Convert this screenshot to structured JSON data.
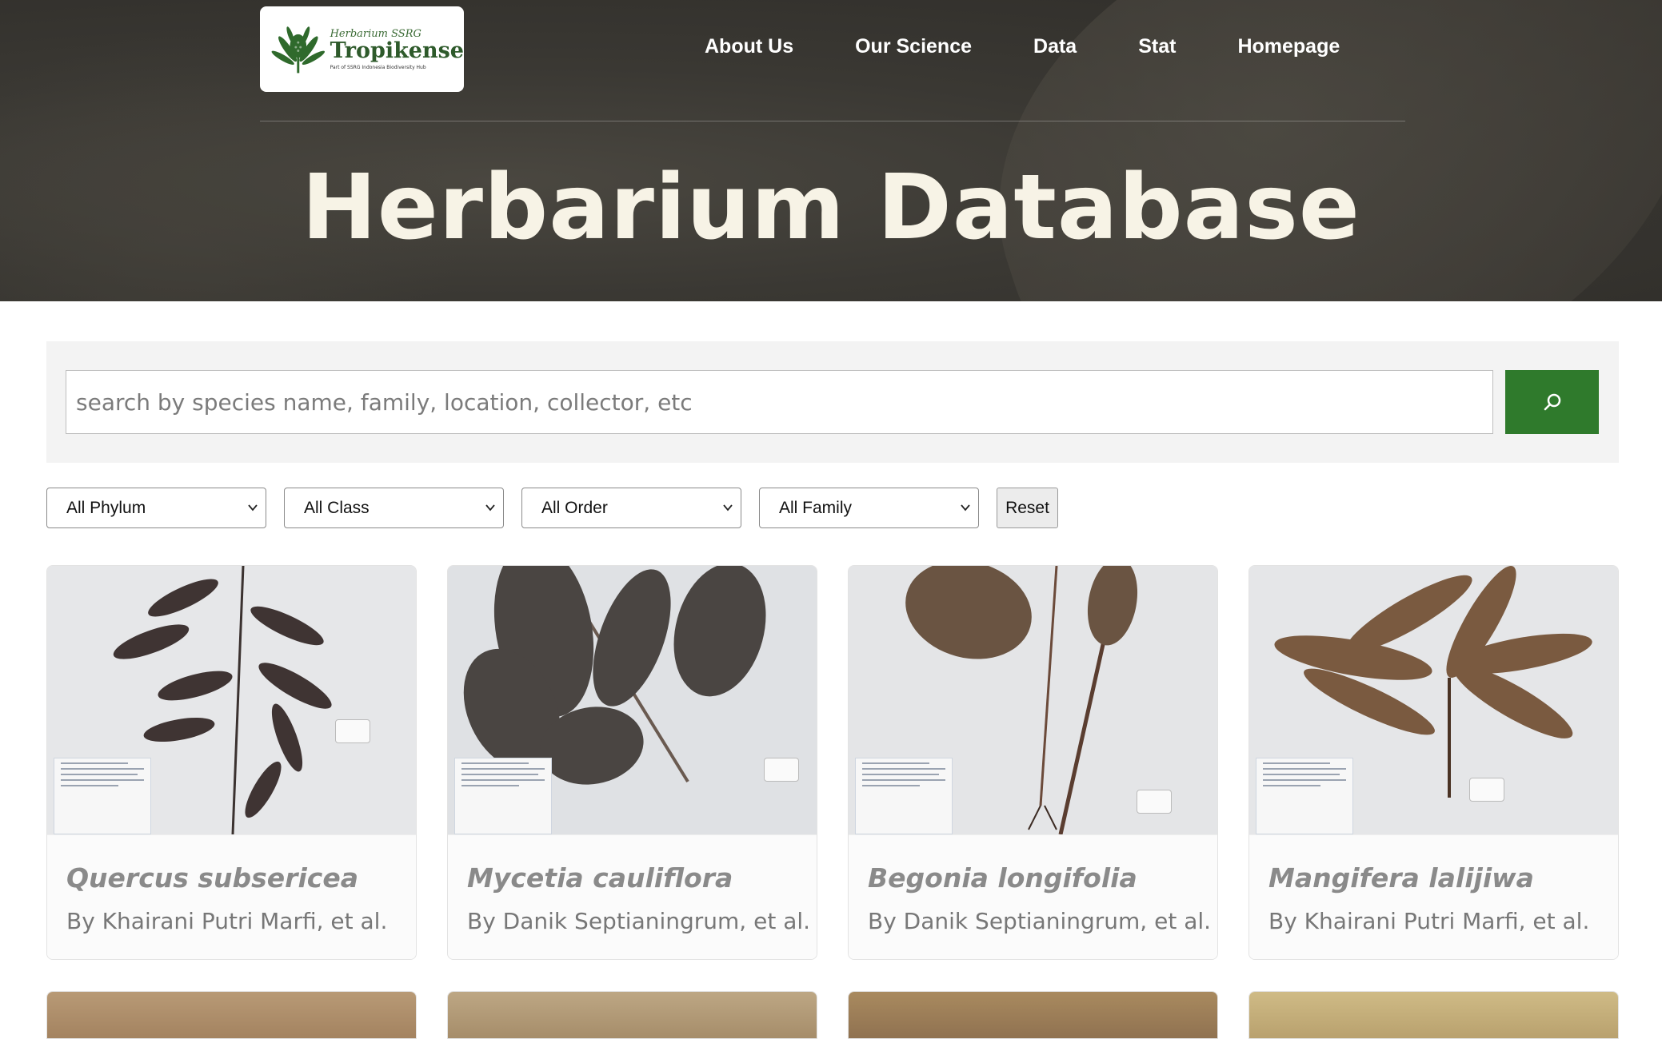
{
  "logo": {
    "script_text": "Herbarium SSRG",
    "brand": "Tropikense",
    "part_text": "Part of SSRG Indonesia Biodiversity Hub"
  },
  "nav": {
    "items": [
      {
        "label": "About Us"
      },
      {
        "label": "Our Science"
      },
      {
        "label": "Data"
      },
      {
        "label": "Stat"
      },
      {
        "label": "Homepage"
      }
    ]
  },
  "hero": {
    "title": "Herbarium Database"
  },
  "search": {
    "placeholder": "search by species name, family, location, collector, etc",
    "button_icon": "search-icon"
  },
  "filters": {
    "phylum": "All Phylum",
    "class": "All Class",
    "order": "All Order",
    "family": "All Family",
    "reset_label": "Reset"
  },
  "cards": [
    {
      "name": "Quercus subsericea",
      "by": "By Khairani Putri Marfi, et al."
    },
    {
      "name": "Mycetia cauliflora",
      "by": "By Danik Septianingrum, et al."
    },
    {
      "name": "Begonia longifolia",
      "by": "By Danik Septianingrum, et al."
    },
    {
      "name": "Mangifera lalijiwa",
      "by": "By Khairani Putri Marfi, et al."
    }
  ],
  "colors": {
    "accent": "#2f7a2c",
    "hero_title": "#f7f3e6"
  }
}
